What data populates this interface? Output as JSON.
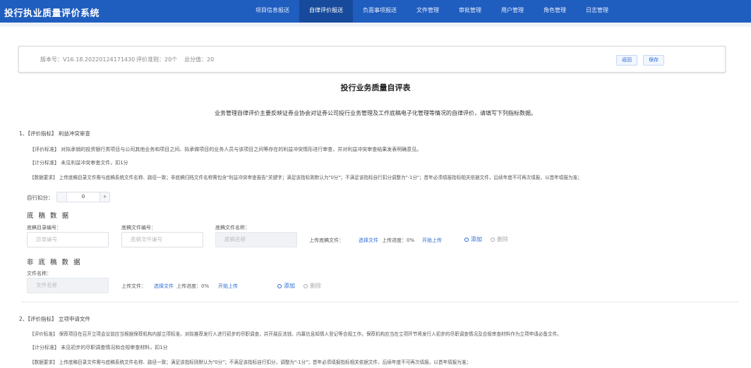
{
  "app": {
    "title": "投行执业质量评价系统"
  },
  "nav": {
    "items": [
      "项目信息报送",
      "自律评价报送",
      "负面事项报送",
      "文件管理",
      "审批管理",
      "用户管理",
      "角色管理",
      "日志管理"
    ],
    "active": "自律评价报送"
  },
  "info": {
    "version": "版本号：V16.18.20220124171430",
    "count": "评价准则：20个",
    "score": "总分值：20",
    "back_label": "返回",
    "save_label": "保存"
  },
  "page": {
    "title": "投行业务质量自评表",
    "intro": "业务管理自律评价主要反映证券业协会对证券公司投行业务管理及工作底稿电子化管理等情况的自律评价，请填写下列指标数据。"
  },
  "item1": {
    "title": "1、【评价指标】 利益冲突审查",
    "standard": "【评价标准】 对拟承销的投资银行类项目与公司其他业务和项目之间、拟承做项目的业务人员与该项目之间等存在的利益冲突情形进行审查，并对利益冲突审查结果发表明确意见。",
    "scoring": "【计分标准】 未见利益冲突审查文件，扣1分",
    "data_req": "【数据要求】 上传底稿目录文件需与底稿系统文件名称、路径一致；非底稿归档文件名称需包含\"利益冲突审查报告\"关键字；满足该指标则默认为\"0分\"；不满足该指标自行扣分调整为\"-1分\"；首年必须填报指标相关依据文件，后续年度不可再次填报，以首年填报为准；",
    "self_score_label": "自行扣分：",
    "self_score_value": "0",
    "stepper_plus": "+"
  },
  "draft": {
    "heading": "底 稿 数 据",
    "dir_label": "底稿目录编号：",
    "dir_placeholder": "目录编号",
    "file_no_label": "底稿文件编号：",
    "file_no_placeholder": "底稿文件编号",
    "file_name_label": "底稿文件名称：",
    "file_name_placeholder": "底稿名称",
    "upload_label": "上传底稿文件：",
    "select_label": "选择文件",
    "progress_label": "上传进度：0%",
    "start_label": "开始上传",
    "add_label": "添加",
    "delete_label": "删除"
  },
  "nondraft": {
    "heading": "非 底 稿 数 据",
    "name_label": "文件名称：",
    "name_placeholder": "文件名称",
    "upload_label": "上传文件：",
    "select_label": "选择文件",
    "progress_label": "上传进度：0%",
    "start_label": "开始上传",
    "add_label": "添加",
    "delete_label": "删除"
  },
  "item2": {
    "title": "2、【评价指标】 立项申请文件",
    "standard": "【评价标准】 保荐项目在召开立项会议前应当根据保荐机构内部立项标准，对拟推荐发行人进行初步的尽职调查，并开展反洗钱、内幕信息知情人登记等合规工作。保荐机构应当在立项环节将发行人初步的尽职调查情况及合规审查材料作为立项申请必备文件。",
    "scoring": "【计分标准】 未见初步的尽职调查情况和合规审查材料，扣1分",
    "data_req": "【数据要求】 上传底稿目录文件需与底稿系统文件名称、路径一致；满足该指标则默认为\"0分\"；不满足该指标自行扣分，调整为\"-1分\"；首年必须填报指标相关依据文件，后续年度不可再次填报，以首年填报为准；"
  }
}
